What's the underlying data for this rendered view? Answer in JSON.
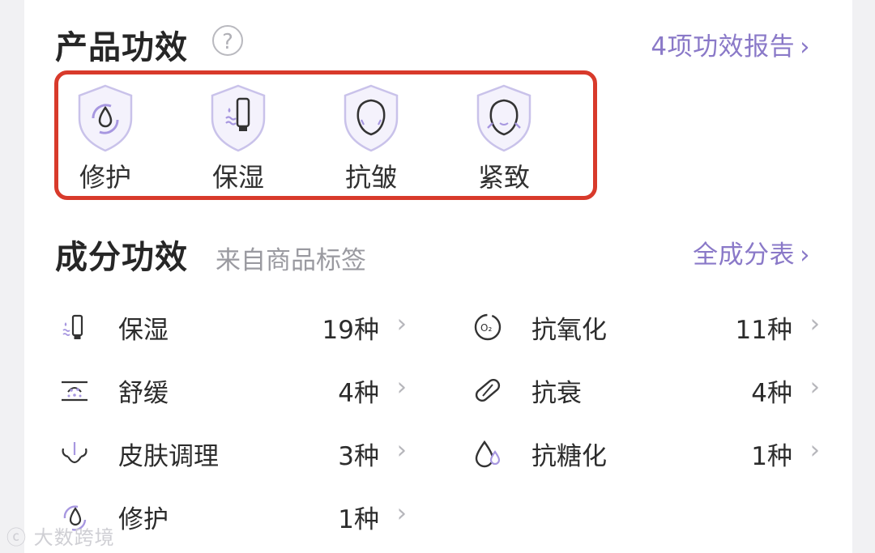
{
  "product_section": {
    "title": "产品功效",
    "help_icon": "question-circle-icon",
    "report_link": "4项功效报告",
    "effects": [
      {
        "label": "修护",
        "icon": "repair-drop-shield-icon"
      },
      {
        "label": "保湿",
        "icon": "moisture-tube-shield-icon"
      },
      {
        "label": "抗皱",
        "icon": "face-shield-icon"
      },
      {
        "label": "紧致",
        "icon": "firming-face-shield-icon"
      }
    ]
  },
  "ingredient_section": {
    "title": "成分功效",
    "subtitle": "来自商品标签",
    "table_link": "全成分表",
    "left": [
      {
        "name": "保湿",
        "count": "19种",
        "icon": "moisture-tube-icon"
      },
      {
        "name": "舒缓",
        "count": "4种",
        "icon": "soothe-dots-icon"
      },
      {
        "name": "皮肤调理",
        "count": "3种",
        "icon": "skin-hair-icon"
      },
      {
        "name": "修护",
        "count": "1种",
        "icon": "repair-drop-icon"
      }
    ],
    "right": [
      {
        "name": "抗氧化",
        "count": "11种",
        "icon": "o2-circle-icon"
      },
      {
        "name": "抗衰",
        "count": "4种",
        "icon": "capsule-icon"
      },
      {
        "name": "抗糖化",
        "count": "1种",
        "icon": "drops-icon"
      }
    ]
  },
  "watermark": "大数跨境",
  "colors": {
    "accent": "#8a79c8",
    "highlight_border": "#d83a2b",
    "icon_purple": "#b3a8e6"
  }
}
